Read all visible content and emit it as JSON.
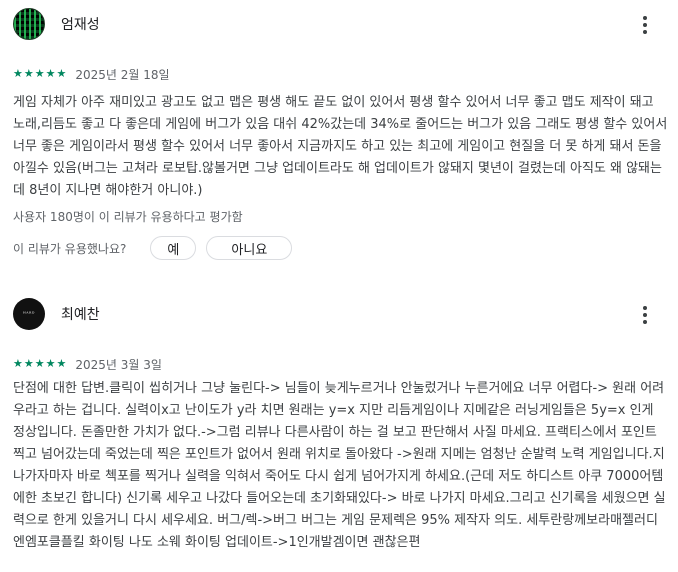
{
  "reviews": [
    {
      "author": "엄재성",
      "rating": 5,
      "date": "2025년 2월 18일",
      "text": "게임 자체가 아주 재미있고 광고도 없고 맵은 평생 해도 끝도 없이 있어서 평생 할수 있어서 너무 좋고 맵도 제작이 돼고 노래,리듬도 좋고 다 좋은데 게임에 버그가 있음 대쉬 42%갔는데 34%로 줄어드는 버그가 있음 그래도 평생 할수 있어서 너무 좋은 게임이라서 평생 할수 있어서 너무 좋아서 지금까지도 하고 있는 최고에 게임이고 현질을 더 못 하게 돼서 돈을 아낄수 있음(버그는 고쳐라 로보탑.않볼거면 그냥 업데이트라도 해 업데이트가 않돼지 몇년이 걸렸는데 아직도 왜 않돼는데 8년이 지나면 해야한거 아니야.)",
      "helpful_count": "사용자 180명이 이 리뷰가 유용하다고 평가함",
      "helpful_question": "이 리뷰가 유용했나요?",
      "yes_label": "예",
      "no_label": "아니요"
    },
    {
      "author": "최예찬",
      "rating": 5,
      "date": "2025년 3월 3일",
      "text": "단점에 대한 답변.클릭이 씹히거나 그냥 눌린다-> 님들이 늦게누르거나 안눌렀거나 누른거에요 너무 어렵다-> 원래 어려우라고 하는 겁니다. 실력이x고 난이도가 y라 치면 원래는 y=x 지만 리듬게임이나 지메같은 러닝게임들은 5y=x 인게 정상입니다. 돈졸만한 가치가 없다.->그럼 리뷰나 다른사람이 하는 걸 보고 판단해서 사질 마세요. 프랙티스에서 포인트 찍고 넘어갔는데 죽었는데 찍은 포인트가 없어서 원래 위치로 돌아왔다 ->원래 지메는 엄청난 순발력 노력 게임입니다.지나가자마자 바로 첵포를 찍거나 실력을 익혀서 죽어도 다시 쉽게 넘어가지게 하세요.(근데 저도 하디스트 아쿠 7000어템에한 초보긴 합니다) 신기록 세우고 나갔다 들어오는데 초기화돼있다-> 바로 나가지 마세요.그리고 신기록을 세웠으면 실력으로 한게 있을거니 다시 세우세요. 버그/렉->버그 버그는 게임 문제렉은 95% 제작자 의도. 세투란랑께보라매젤러디엔엠포클플킬 화이팅 나도 소웨 화이팅 업데이트->1인개발겜이면 괜찮은편"
    }
  ],
  "icons": {
    "star": "star-icon",
    "more": "more-vert-icon"
  },
  "colors": {
    "star": "#01875f",
    "text": "#3c4043",
    "muted": "#5f6368",
    "border": "#dadce0"
  }
}
